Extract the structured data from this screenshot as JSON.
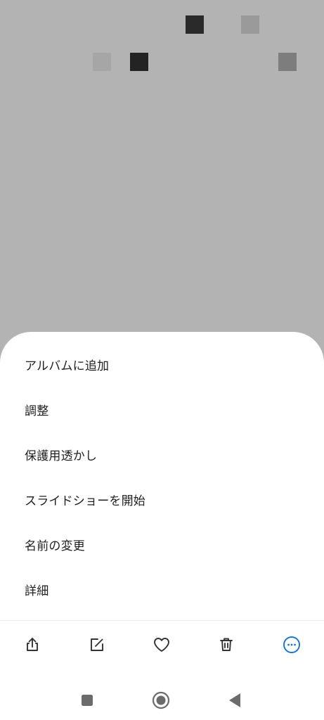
{
  "photo": {
    "background": "#b3b3b3",
    "pixels": [
      {
        "name": "pixel-dark-1",
        "color": "#2a2a2a"
      },
      {
        "name": "pixel-mid-1",
        "color": "#9a9a9a"
      },
      {
        "name": "pixel-light-1",
        "color": "#a6a6a6"
      },
      {
        "name": "pixel-dark-2",
        "color": "#232323"
      },
      {
        "name": "pixel-mid-2",
        "color": "#7d7d7d"
      }
    ]
  },
  "menu": {
    "items": [
      {
        "label": "アルバムに追加"
      },
      {
        "label": "調整"
      },
      {
        "label": "保護用透かし"
      },
      {
        "label": "スライドショーを開始"
      },
      {
        "label": "名前の変更"
      },
      {
        "label": "詳細"
      }
    ]
  },
  "actions": [
    {
      "icon": "share-icon"
    },
    {
      "icon": "edit-icon"
    },
    {
      "icon": "heart-icon"
    },
    {
      "icon": "trash-icon"
    },
    {
      "icon": "more-icon",
      "active": true
    }
  ],
  "colors": {
    "icon": "#333333",
    "accent": "#1a73c8",
    "nav": "#6b6b6b"
  },
  "navigation": [
    {
      "icon": "recents-square-icon"
    },
    {
      "icon": "home-circle-icon"
    },
    {
      "icon": "back-triangle-icon"
    }
  ]
}
